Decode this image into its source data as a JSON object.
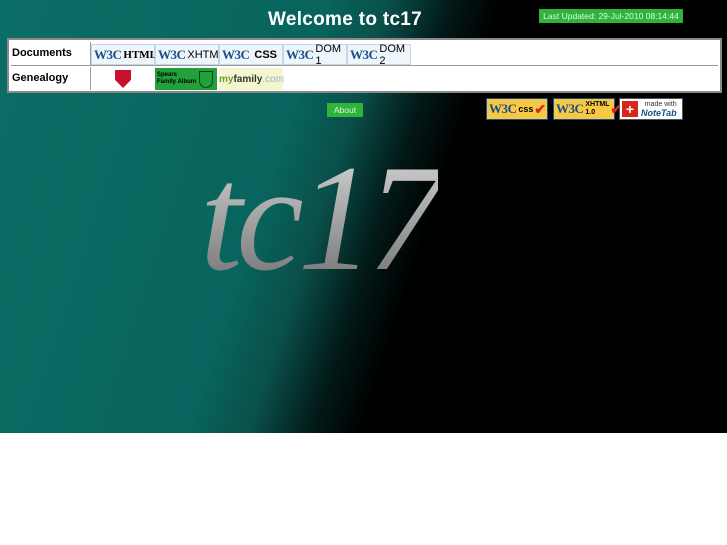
{
  "page": {
    "title": "Welcome to tc17",
    "last_updated": "Last Updated: 29-Jul-2010 08:14:44"
  },
  "menu": {
    "documents": {
      "label": "Documents",
      "items": [
        {
          "prefix": "W3C",
          "label": "HTML"
        },
        {
          "prefix": "W3C",
          "label": "XHTML"
        },
        {
          "prefix": "W3C",
          "label": "CSS"
        },
        {
          "prefix": "W3C",
          "label": "DOM 1"
        },
        {
          "prefix": "W3C",
          "label": "DOM 2"
        }
      ]
    },
    "genealogy": {
      "label": "Genealogy",
      "items": [
        {
          "icon": "shield-crest-icon"
        },
        {
          "text": "Spears Family Album",
          "icon": "family-crest-icon"
        },
        {
          "text_my": "my",
          "text_family": "family",
          "text_com": ".com"
        }
      ]
    }
  },
  "about": {
    "label": "About"
  },
  "badges": {
    "css": {
      "prefix": "W3C",
      "label": "css"
    },
    "xhtml": {
      "prefix": "W3C",
      "label": "XHTML 1.0"
    },
    "notetab": {
      "line1": "made with",
      "line2": "NoteTab"
    }
  },
  "logo": {
    "text": "tc17"
  },
  "colors": {
    "teal": "#0b6e66",
    "green_button": "#2fb33b",
    "w3c_blue": "#1a4d8c"
  }
}
